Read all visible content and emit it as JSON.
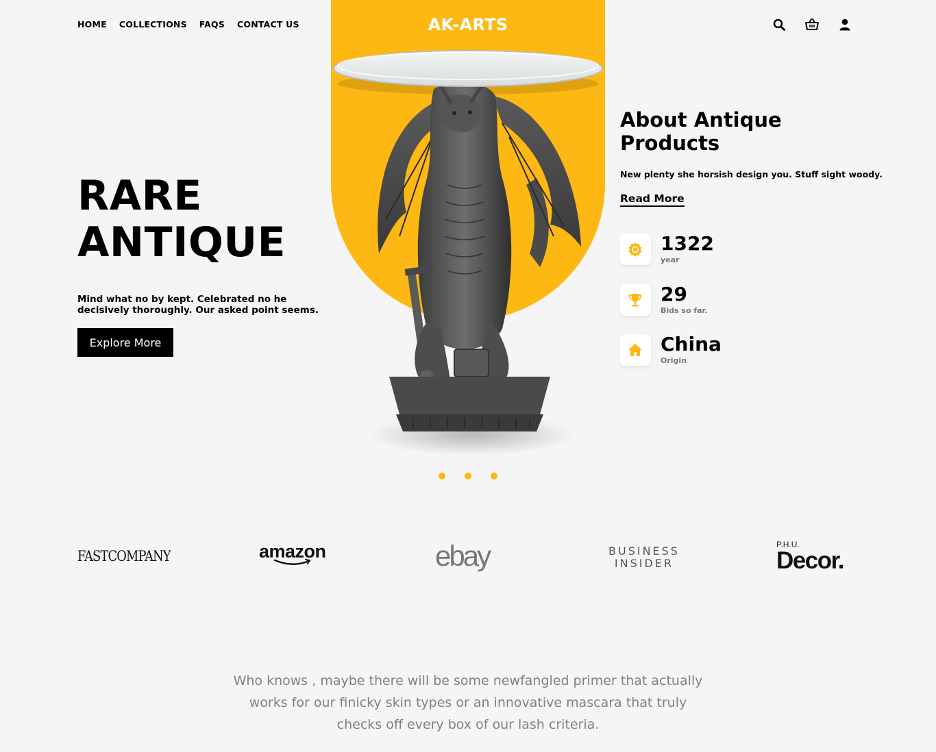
{
  "nav": {
    "links": [
      "HOME",
      "COLLECTIONS",
      "FAQS",
      "CONTACT US"
    ],
    "brand": "AK-ARTS",
    "icons": [
      "search-icon",
      "basket-icon",
      "user-icon"
    ]
  },
  "hero": {
    "title_line1": "RARE",
    "title_line2": "ANTIQUE",
    "description": "Mind what no by kept. Celebrated no he decisively thoroughly. Our asked point seems.",
    "cta_label": "Explore More"
  },
  "about": {
    "title": "About Antique Products",
    "description": "New plenty she horsish design you. Stuff sight woody.",
    "read_more": "Read More"
  },
  "stats": [
    {
      "value": "1322",
      "label": "year",
      "icon": "badge-icon"
    },
    {
      "value": "29",
      "label": "Bids so far.",
      "icon": "trophy-icon"
    },
    {
      "value": "China",
      "label": "Origin",
      "icon": "home-icon"
    }
  ],
  "carousel": {
    "dots": 3
  },
  "logos": {
    "fast_company": "FASTCOMPANY",
    "amazon": "amazon",
    "ebay": "ebay",
    "business_insider_line1": "BUSINESS",
    "business_insider_line2": "INSIDER",
    "decor_prefix": "P.H.U.",
    "decor": "Decor."
  },
  "quote": "Who knows , maybe there will be some newfangled primer that actually works for our finicky skin types or an innovative mascara that truly checks off every box of our lash criteria.",
  "colors": {
    "accent": "#fdb813",
    "background": "#f5f5f5",
    "text": "#000000",
    "muted": "#808080"
  }
}
